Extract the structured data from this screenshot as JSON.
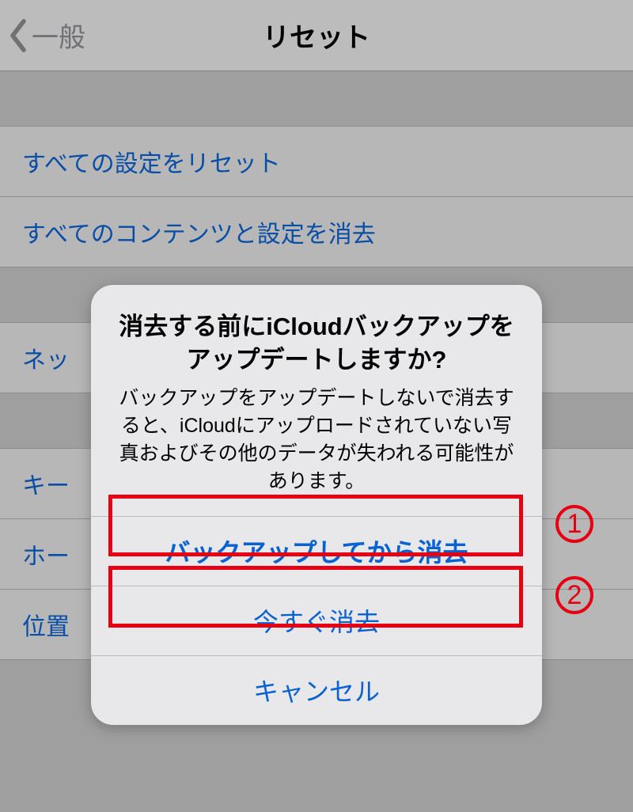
{
  "nav": {
    "back_label": "一般",
    "title": "リセット"
  },
  "list": {
    "items": [
      "すべての設定をリセット",
      "すべてのコンテンツと設定を消去",
      "ネッ",
      "キー",
      "ホー",
      "位置"
    ]
  },
  "alert": {
    "title": "消去する前にiCloudバックアップをアップデートしますか?",
    "message": "バックアップをアップデートしないで消去すると、iCloudにアップロードされていない写真およびその他のデータが失われる可能性があります。",
    "backup_label": "バックアップしてから消去",
    "erase_label": "今すぐ消去",
    "cancel_label": "キャンセル"
  },
  "annotations": {
    "badge1": "1",
    "badge2": "2"
  }
}
